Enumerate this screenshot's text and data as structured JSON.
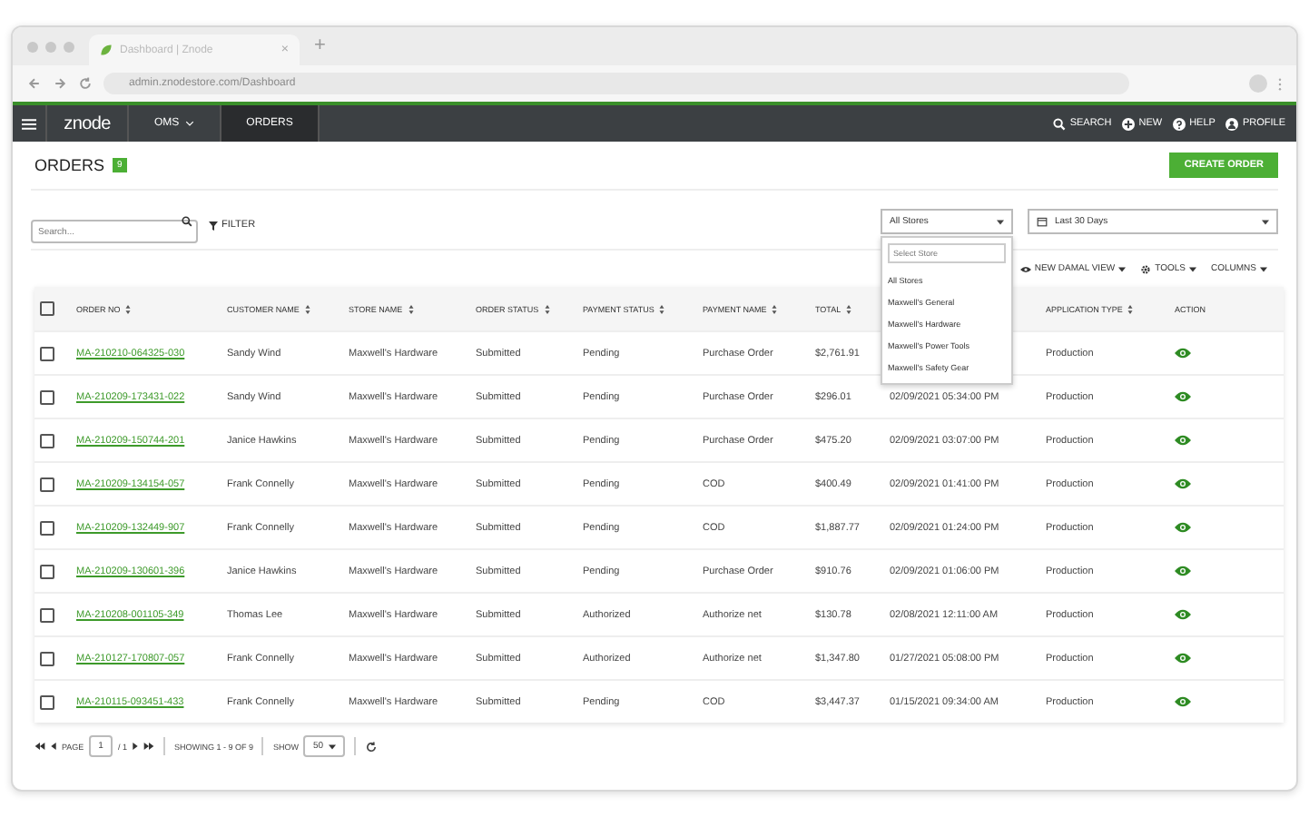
{
  "browser": {
    "tab_title": "Dashboard | Znode",
    "tab_close": "×",
    "new_tab": "+",
    "url": "admin.znodestore.com/Dashboard"
  },
  "nav": {
    "logo": "znode",
    "menus": [
      {
        "label": "OMS",
        "dropdown": true,
        "selected": false
      },
      {
        "label": "ORDERS",
        "dropdown": false,
        "selected": true
      }
    ],
    "actions": [
      {
        "kind": "search",
        "label": "SEARCH"
      },
      {
        "kind": "new",
        "label": "NEW"
      },
      {
        "kind": "help",
        "label": "HELP"
      },
      {
        "kind": "profile",
        "label": "PROFILE"
      }
    ]
  },
  "page": {
    "title": "ORDERS",
    "count": "9",
    "create_button": "CREATE ORDER"
  },
  "filters": {
    "search_placeholder": "Search...",
    "filter_label": "FILTER",
    "store_select": "All Stores",
    "date_select": "Last 30 Days",
    "store_dropdown": {
      "search_placeholder": "Select Store",
      "options": [
        {
          "label": "All Stores",
          "selected": false
        },
        {
          "label": "Maxwell's General",
          "selected": false
        },
        {
          "label": "Maxwell's Hardware",
          "selected": false
        },
        {
          "label": "Maxwell's Power Tools",
          "selected": false
        },
        {
          "label": "Maxwell's Safety Gear",
          "selected": false
        }
      ]
    }
  },
  "toolbar": [
    "NEW DAMAL VIEW",
    "TOOLS",
    "COLUMNS"
  ],
  "table": {
    "select_all_checked": false,
    "columns": [
      {
        "label": "ORDER NO",
        "sortable": true
      },
      {
        "label": "CUSTOMER NAME",
        "sortable": true
      },
      {
        "label": "STORE NAME",
        "sortable": true
      },
      {
        "label": "ORDER STATUS",
        "sortable": true
      },
      {
        "label": "PAYMENT STATUS",
        "sortable": true
      },
      {
        "label": "PAYMENT NAME",
        "sortable": true
      },
      {
        "label": "TOTAL",
        "sortable": true
      },
      {
        "label": "APPLICATION TYPE",
        "sortable": true
      },
      {
        "label": "ACTION",
        "sortable": false
      }
    ],
    "rows": [
      {
        "checked": false,
        "order_no": "MA-210210-064325-030",
        "customer": "Sandy Wind",
        "store": "Maxwell's Hardware",
        "order_status": "Submitted",
        "payment_status": "Pending",
        "payment_name": "Purchase Order",
        "total": "$2,761.91",
        "app_type": "Production"
      },
      {
        "checked": false,
        "order_no": "MA-210209-173431-022",
        "customer": "Sandy Wind",
        "store": "Maxwell's Hardware",
        "order_status": "Submitted",
        "payment_status": "Pending",
        "payment_name": "Purchase Order",
        "total": "$296.01",
        "date": "02/09/2021 05:34:00 PM",
        "app_type": "Production"
      },
      {
        "checked": false,
        "order_no": "MA-210209-150744-201",
        "customer": "Janice Hawkins",
        "store": "Maxwell's Hardware",
        "order_status": "Submitted",
        "payment_status": "Pending",
        "payment_name": "Purchase Order",
        "total": "$475.20",
        "date": "02/09/2021 03:07:00 PM",
        "app_type": "Production"
      },
      {
        "checked": false,
        "order_no": "MA-210209-134154-057",
        "customer": "Frank Connelly",
        "store": "Maxwell's Hardware",
        "order_status": "Submitted",
        "payment_status": "Pending",
        "payment_name": "COD",
        "total": "$400.49",
        "date": "02/09/2021 01:41:00 PM",
        "app_type": "Production"
      },
      {
        "checked": false,
        "order_no": "MA-210209-132449-907",
        "customer": "Frank Connelly",
        "store": "Maxwell's Hardware",
        "order_status": "Submitted",
        "payment_status": "Pending",
        "payment_name": "COD",
        "total": "$1,887.77",
        "date": "02/09/2021 01:24:00 PM",
        "app_type": "Production"
      },
      {
        "checked": false,
        "order_no": "MA-210209-130601-396",
        "customer": "Janice Hawkins",
        "store": "Maxwell's Hardware",
        "order_status": "Submitted",
        "payment_status": "Pending",
        "payment_name": "Purchase Order",
        "total": "$910.76",
        "date": "02/09/2021 01:06:00 PM",
        "app_type": "Production"
      },
      {
        "checked": false,
        "order_no": "MA-210208-001105-349",
        "customer": "Thomas Lee",
        "store": "Maxwell's Hardware",
        "order_status": "Submitted",
        "payment_status": "Authorized",
        "payment_name": "Authorize net",
        "total": "$130.78",
        "date": "02/08/2021 12:11:00 AM",
        "app_type": "Production"
      },
      {
        "checked": false,
        "order_no": "MA-210127-170807-057",
        "customer": "Frank Connelly",
        "store": "Maxwell's Hardware",
        "order_status": "Submitted",
        "payment_status": "Authorized",
        "payment_name": "Authorize net",
        "total": "$1,347.80",
        "date": "01/27/2021 05:08:00 PM",
        "app_type": "Production"
      },
      {
        "checked": false,
        "order_no": "MA-210115-093451-433",
        "customer": "Frank Connelly",
        "store": "Maxwell's Hardware",
        "order_status": "Submitted",
        "payment_status": "Pending",
        "payment_name": "COD",
        "total": "$3,447.37",
        "date": "01/15/2021 09:34:00 AM",
        "app_type": "Production"
      }
    ]
  },
  "pager": {
    "page_label": "PAGE",
    "page": "1",
    "of": "/ 1",
    "showing": "SHOWING 1 - 9 OF 9",
    "show_label": "SHOW",
    "page_size": "50"
  }
}
